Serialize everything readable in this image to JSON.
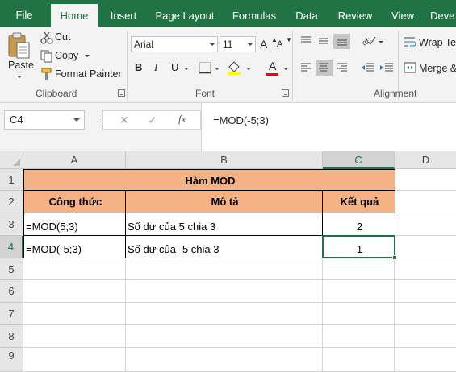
{
  "tabs": {
    "file": "File",
    "home": "Home",
    "insert": "Insert",
    "page_layout": "Page Layout",
    "formulas": "Formulas",
    "data": "Data",
    "review": "Review",
    "view": "View",
    "developer_partial": "Deve"
  },
  "clipboard": {
    "paste": "Paste",
    "cut": "Cut",
    "copy": "Copy",
    "format_painter": "Format Painter",
    "group_label": "Clipboard"
  },
  "font": {
    "name": "Arial",
    "size": "11",
    "bold": "B",
    "italic": "I",
    "underline": "U",
    "grow": "A",
    "shrink": "A",
    "color_letter": "A",
    "group_label": "Font",
    "font_color": "#ff0000",
    "fill_color": "#ffff00"
  },
  "alignment": {
    "wrap_text": "Wrap Tex",
    "merge": "Merge &",
    "group_label": "Alignment"
  },
  "formula_bar": {
    "name_box": "C4",
    "cancel_glyph": "✕",
    "enter_glyph": "✓",
    "fx": "fx",
    "formula": "=MOD(-5;3)"
  },
  "columns": [
    "A",
    "B",
    "C",
    "D"
  ],
  "rows": [
    "1",
    "2",
    "3",
    "4",
    "5",
    "6",
    "7",
    "8",
    "9"
  ],
  "sheet": {
    "title": "Hàm MOD",
    "headers": [
      "Công thức",
      "Mô tả",
      "Kết quả"
    ],
    "rows": [
      {
        "formula": "=MOD(5;3)",
        "description": "Số dư của 5 chia 3",
        "result": "2"
      },
      {
        "formula": "=MOD(-5;3)",
        "description": "Số dư của -5 chia 3",
        "result": "1"
      }
    ]
  },
  "colors": {
    "excel_green": "#217346",
    "header_fill": "#f4b183"
  }
}
